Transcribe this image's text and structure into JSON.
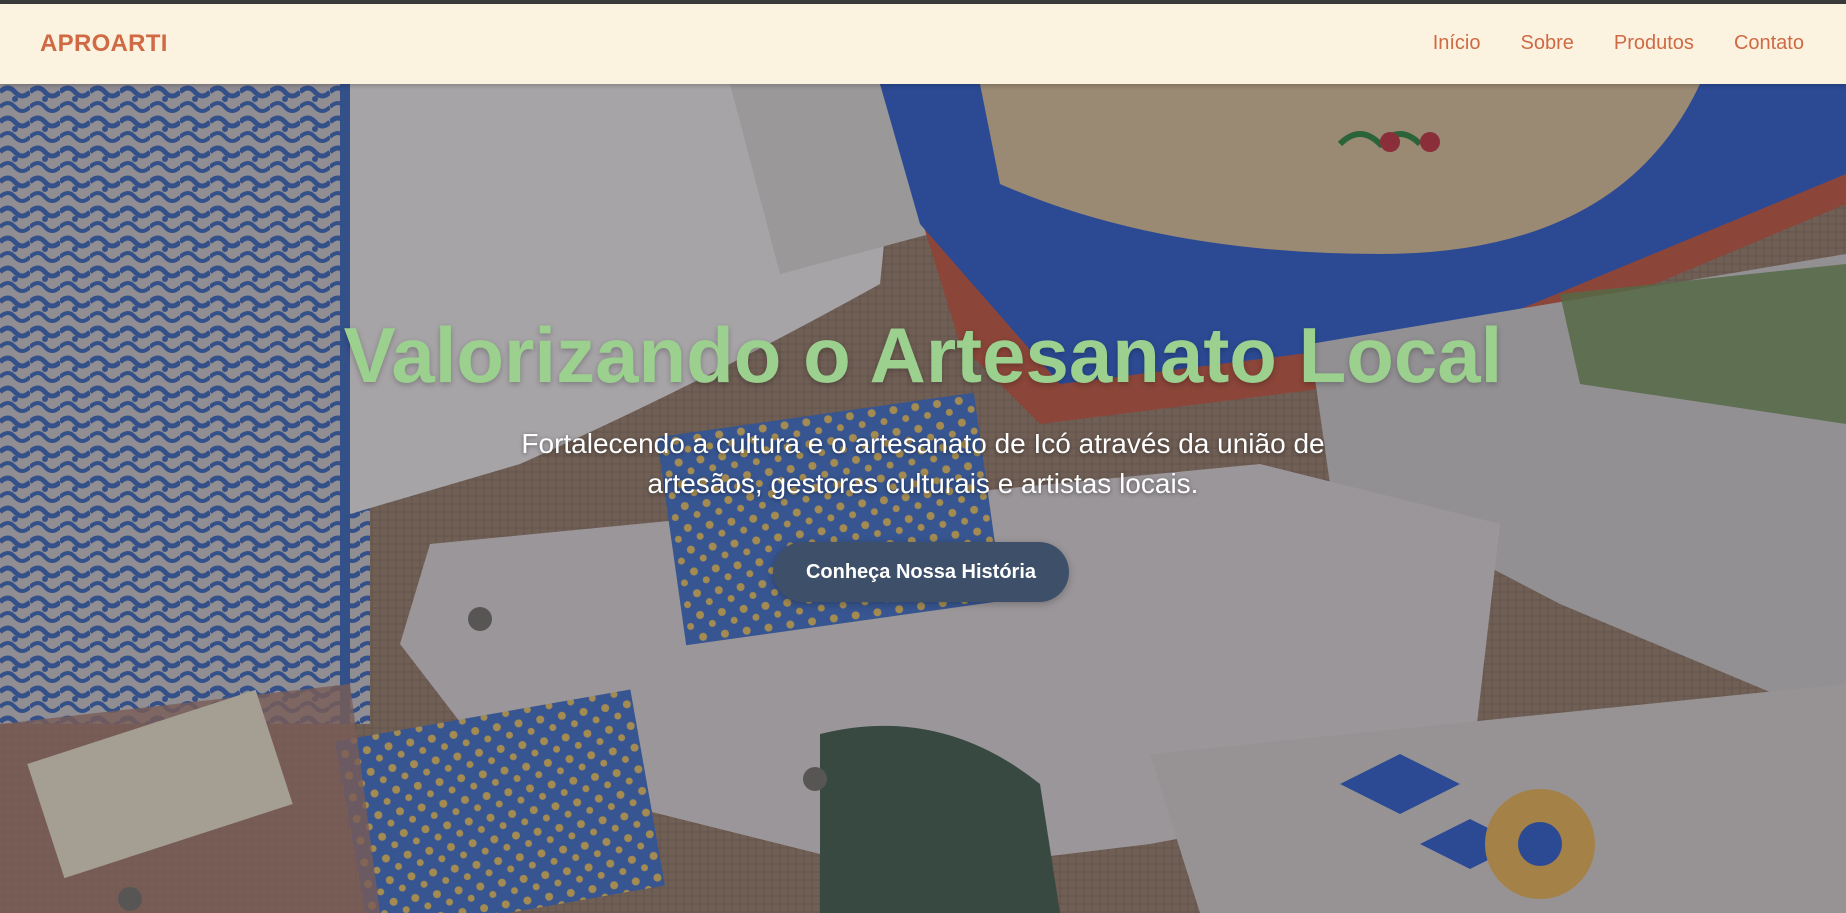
{
  "navbar": {
    "brand": "APROARTI",
    "links": [
      {
        "label": "Início"
      },
      {
        "label": "Sobre"
      },
      {
        "label": "Produtos"
      },
      {
        "label": "Contato"
      }
    ]
  },
  "hero": {
    "title": "Valorizando o Artesanato Local",
    "subtitle": "Fortalecendo a cultura e o artesanato de Icó através da união de artesãos, gestores culturais e artistas locais.",
    "cta_label": "Conheça Nossa História",
    "background_image": "handcrafted embroidered textiles, bags and cushions"
  },
  "colors": {
    "navbar_bg": "#fbf3df",
    "brand": "#cf6a45",
    "title": "#9bd08e",
    "button": "#3e5069"
  }
}
